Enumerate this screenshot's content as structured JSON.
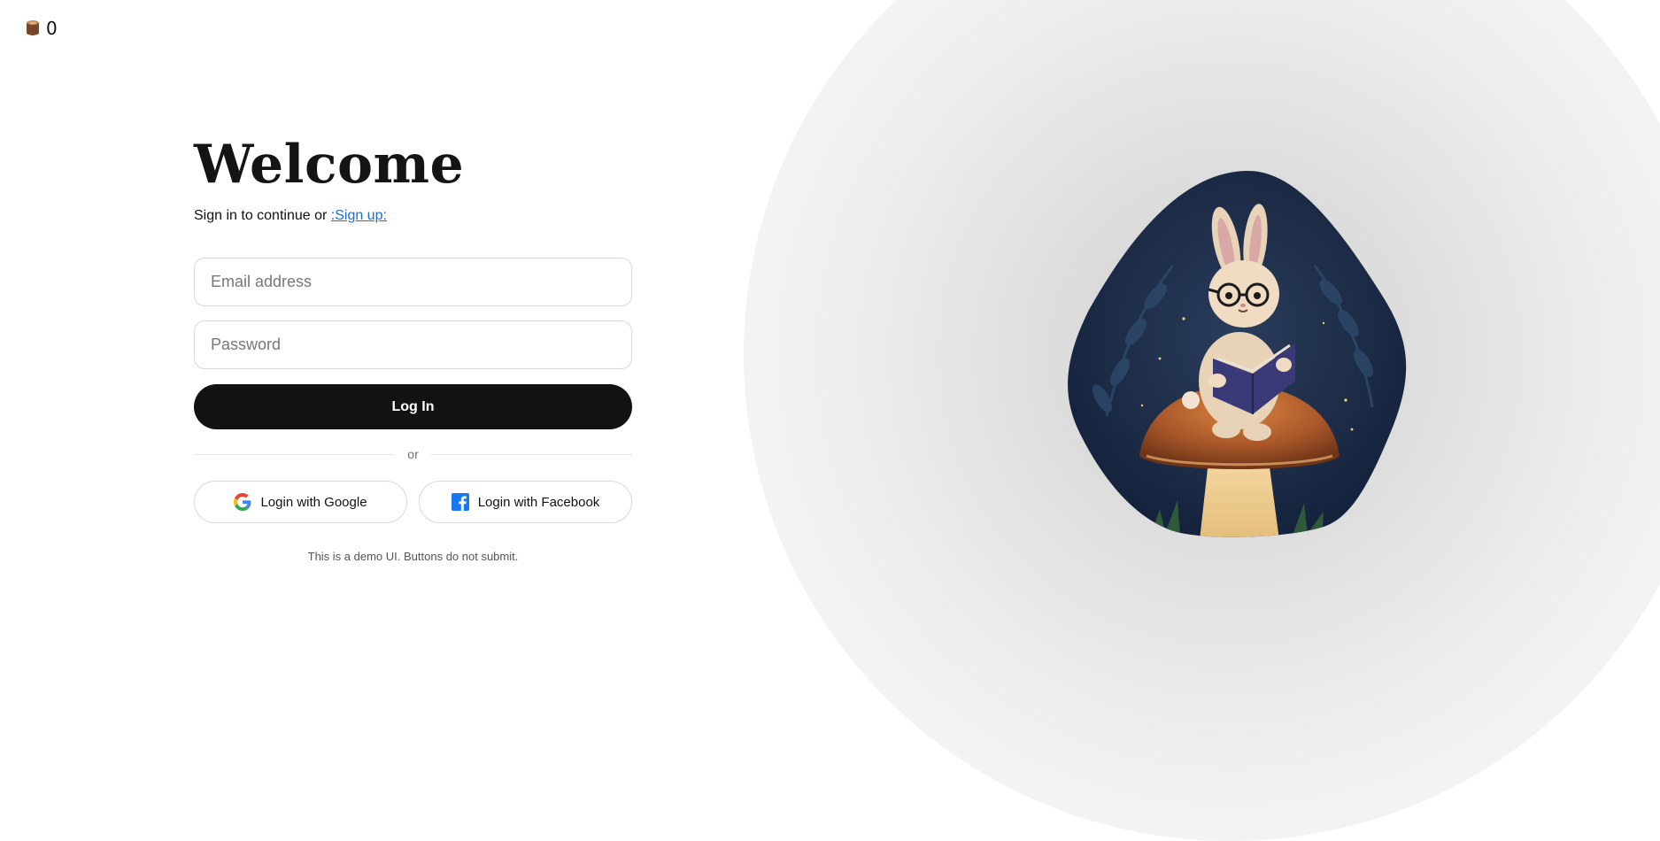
{
  "counter": {
    "icon": "tree-stump-icon",
    "value": "0"
  },
  "login": {
    "title": "Welcome",
    "subtitle_text": "Sign in to continue or ",
    "signup_link": ":Sign up:",
    "email_placeholder": "Email address",
    "password_placeholder": "Password",
    "login_button": "Log In",
    "divider_text": "or",
    "google_button": "Login with Google",
    "facebook_button": "Login with Facebook",
    "demo_note": "This is a demo UI. Buttons do not submit."
  },
  "illustration": {
    "subject": "bunny-reading-on-mushroom",
    "colors": {
      "background": "#1b2a44",
      "mushroom_cap": "#b0612e",
      "book": "#3a3a78"
    }
  },
  "colors": {
    "primary_button": "#121212",
    "link": "#1a6fd6",
    "facebook": "#1877f2"
  }
}
